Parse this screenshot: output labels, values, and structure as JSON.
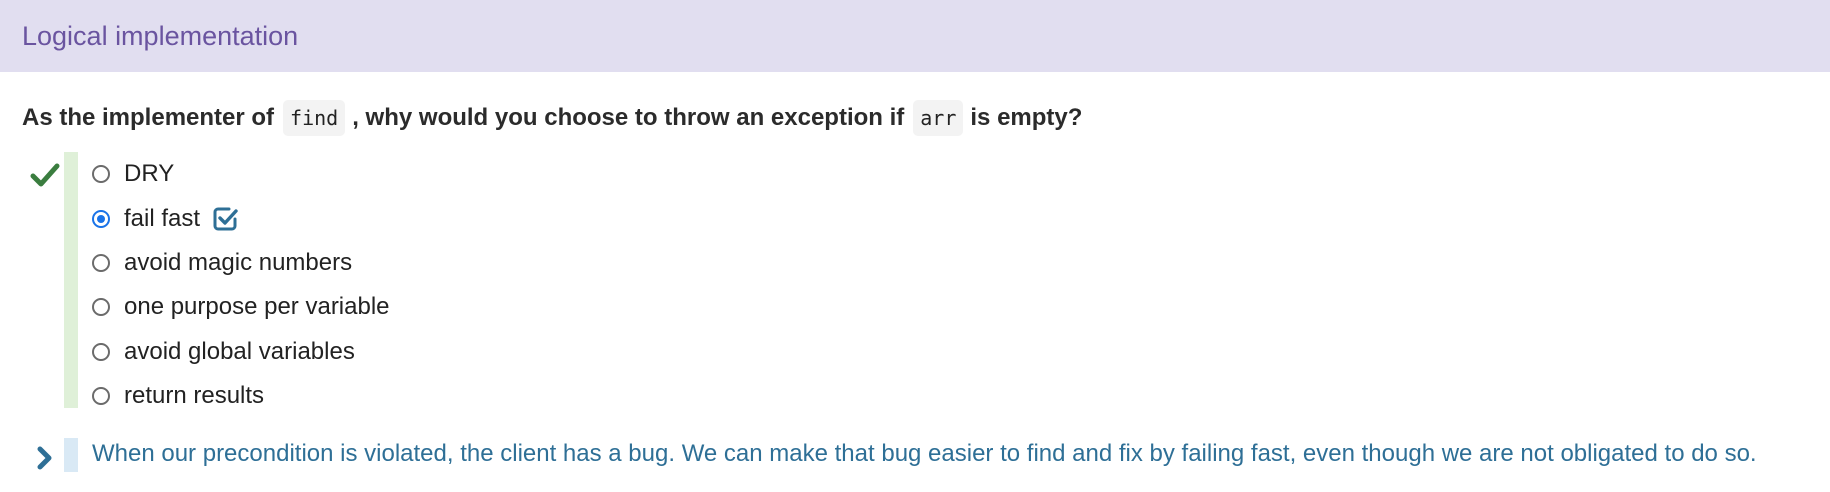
{
  "header": {
    "title": "Logical implementation"
  },
  "question": {
    "prefix": "As the implementer of",
    "code1": "find",
    "middle": ", why would you choose to throw an exception if",
    "code2": "arr",
    "suffix": "is empty?"
  },
  "options": [
    {
      "label": "DRY",
      "selected": false
    },
    {
      "label": "fail fast",
      "selected": true,
      "correct": true
    },
    {
      "label": "avoid magic numbers",
      "selected": false
    },
    {
      "label": "one purpose per variable",
      "selected": false
    },
    {
      "label": "avoid global variables",
      "selected": false
    },
    {
      "label": "return results",
      "selected": false
    }
  ],
  "explanation": {
    "text": "When our precondition is violated, the client has a bug. We can make that bug easier to find and fix by failing fast, even though we are not obligated to do so."
  },
  "colors": {
    "header_bg": "#e1def0",
    "header_text": "#6a54a0",
    "correct_green": "#3a7d3f",
    "explanation_blue": "#2e6f96"
  },
  "icons": {
    "result": "checkmark-icon",
    "answer": "checked-box-icon",
    "expand": "chevron-right-icon"
  }
}
